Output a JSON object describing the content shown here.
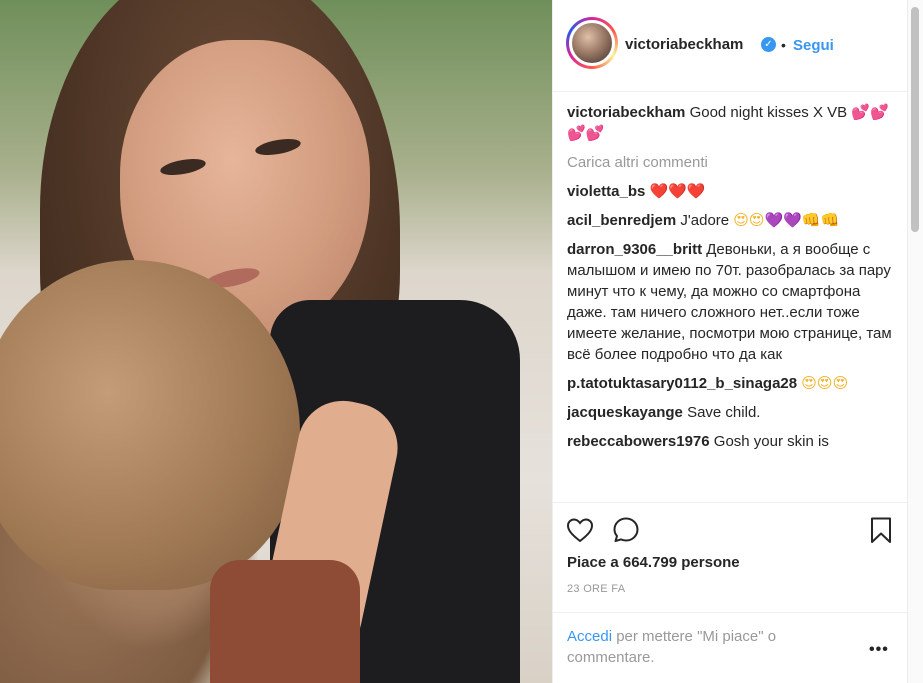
{
  "post": {
    "username": "victoriabeckham",
    "verified_mark": "✓",
    "separator": "•",
    "follow_label": "Segui"
  },
  "caption": {
    "username": "victoriabeckham",
    "text": "Good night kisses X VB",
    "emoji": "💕💕💕💕"
  },
  "load_more_label": "Carica altri commenti",
  "comments": [
    {
      "user": "violetta_bs",
      "text": "",
      "emoji": "❤️❤️❤️"
    },
    {
      "user": "acil_benredjem",
      "text": "J'adore",
      "emoji": "😍😍💜💜👊👊"
    },
    {
      "user": "darron_9306__britt",
      "text": "Девоньки, а я вообще с малышом и имею по 70т. разобралась за пару минут что к чему, да можно со смартфона даже. там ничего сложного нет..если тоже имеете желание, посмотри мою странице, там всё более подробно что да как",
      "emoji": ""
    },
    {
      "user": "p.tatotuktasary0112_b_sinaga28",
      "text": "",
      "emoji": "😍😍😍"
    },
    {
      "user": "jacqueskayange",
      "text": "Save child.",
      "emoji": ""
    },
    {
      "user": "rebeccabowers1976",
      "text": "Gosh your skin is",
      "emoji": ""
    }
  ],
  "likes_text": "Piace a 664.799 persone",
  "time_text": "23 ORE FA",
  "login": {
    "link": "Accedi",
    "rest": " per mettere \"Mi piace\" o commentare."
  },
  "more_label": "•••",
  "icons": {
    "like": "heart-outline-icon",
    "comment": "comment-bubble-icon",
    "save": "bookmark-icon",
    "more": "more-options-icon"
  },
  "colors": {
    "link_blue": "#3897f0",
    "muted": "#999999",
    "text": "#262626"
  }
}
